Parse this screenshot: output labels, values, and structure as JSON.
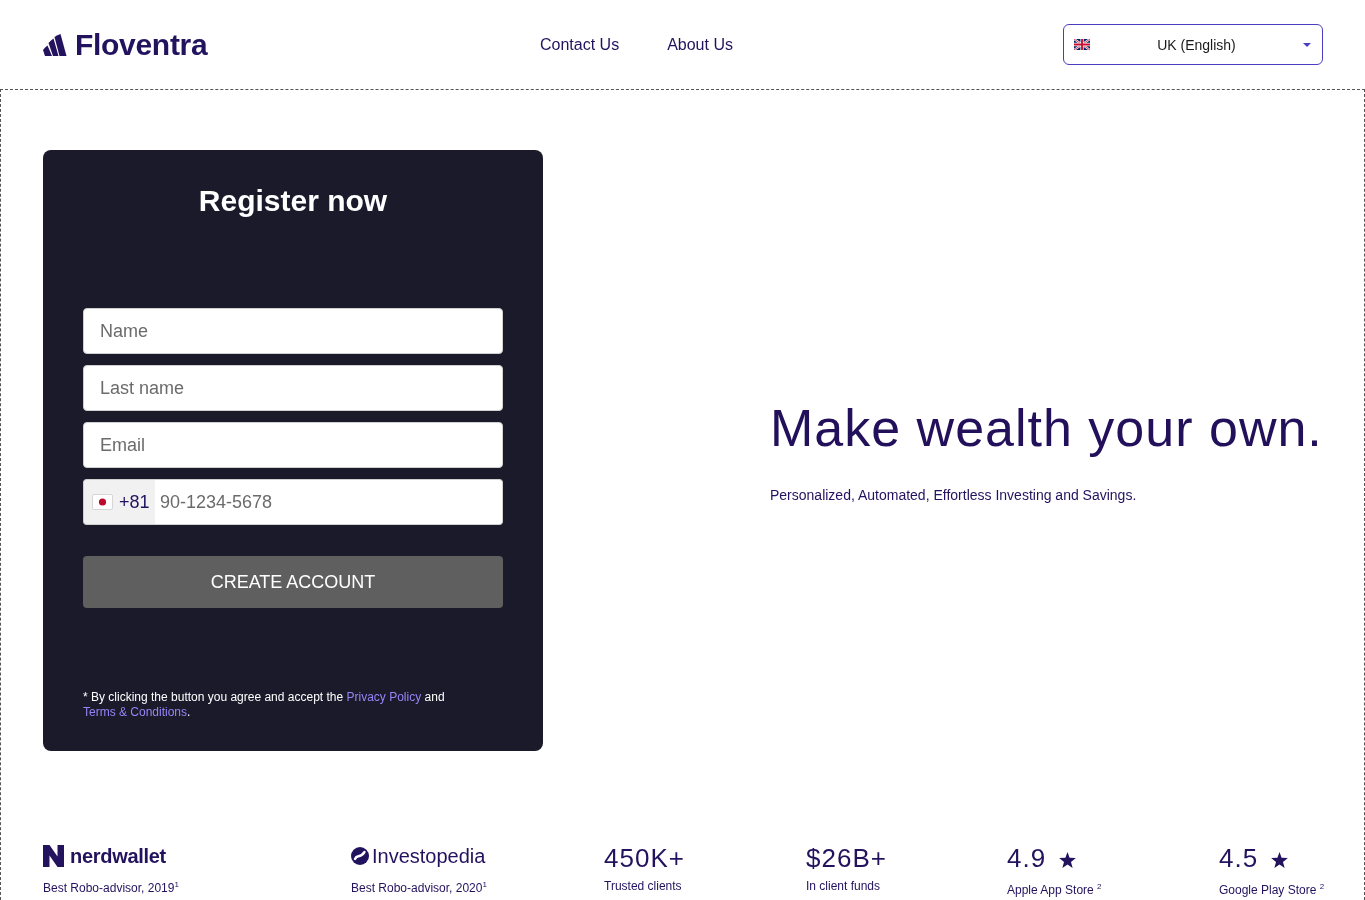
{
  "header": {
    "brand": "Floventra",
    "nav": [
      {
        "label": "Contact Us"
      },
      {
        "label": "About Us"
      }
    ],
    "language": {
      "value": "UK (English)"
    }
  },
  "register": {
    "title": "Register now",
    "fields": [
      {
        "placeholder": "Name"
      },
      {
        "placeholder": "Last name"
      },
      {
        "placeholder": "Email"
      }
    ],
    "phone": {
      "dial_code": "+81",
      "placeholder": "90-1234-5678"
    },
    "submit": "CREATE ACCOUNT",
    "consent": {
      "before": "* By clicking the button you agree and accept the",
      "privacy_link": "Privacy Policy",
      "between": "and",
      "terms_link": "Terms & Conditions",
      "after": "."
    }
  },
  "hero": {
    "headline": "Make wealth your own.",
    "subtitle": "Personalized, Automated, Effortless Investing and Savings."
  },
  "stats": {
    "awards": [
      {
        "kind": "bold",
        "logo": "nerdwallet",
        "caption": "Best Robo-advisor, 2019$^{1}$"
      },
      {
        "kind": "light",
        "logo": "Investopedia",
        "caption": "Best Robo-advisor, 2020$^{1}$"
      }
    ],
    "metrics": [
      {
        "kind": "figure",
        "value": "450K+",
        "label": "Trusted clients"
      },
      {
        "kind": "figure",
        "value": "$26B+",
        "label": "In client funds"
      },
      {
        "kind": "rating",
        "value": "4.9",
        "label": "Apple App Store $^{2}$"
      },
      {
        "kind": "rating",
        "value": "4.5",
        "label": "Google Play Store $^{2}$"
      }
    ]
  }
}
